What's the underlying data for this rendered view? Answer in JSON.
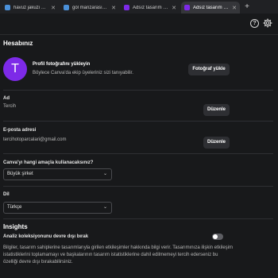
{
  "browser": {
    "tabs": [
      {
        "title": "havuz jakuzi korbe...",
        "color": "#4a90d9",
        "active": false
      },
      {
        "title": "göl manzarası kafe...",
        "color": "#4a90d9",
        "active": false
      },
      {
        "title": "Adsız tasarım - Mob...",
        "color": "#7d2ae8",
        "active": false
      },
      {
        "title": "Adsız tasarım - 108...",
        "color": "#7d2ae8",
        "active": true
      }
    ],
    "new_tab": "+"
  },
  "header": {
    "help_icon": "?",
    "settings_icon": "gear-icon"
  },
  "page": {
    "title": "Hesabınız",
    "photo": {
      "avatar_letter": "T",
      "title": "Profil fotoğrafını yükleyin",
      "description": "Böylece Canva'da ekip üyeleriniz sizi tanıyabilir.",
      "button": "Fotoğraf yükle"
    },
    "name": {
      "label": "Ad",
      "value": "Tercih",
      "button": "Düzenle"
    },
    "email": {
      "label": "E-posta adresi",
      "value": "tercihotoparcalari@gmail.com",
      "button": "Düzenle"
    },
    "usage": {
      "label": "Canva'yı hangi amaçla kullanacaksınız?",
      "value": "Büyük şirket"
    },
    "language": {
      "label": "Dil",
      "value": "Türkçe"
    },
    "insights": {
      "title": "Insights",
      "toggle_label": "Analiz koleksiyonunu devre dışı bırak",
      "toggle_on": false,
      "description": "Bilgiler, tasarım sahiplerine tasarımlarıyla girilen etkileşimler hakkında bilgi verir. Tasarımınıza ilişkin etkileşim istatistiklerini toplamamayı ve başkalarının tasarım istatistiklerine dahil edilmemeyi tercih ederseniz bu özelliği devre dışı bırakabilirsiniz."
    }
  }
}
